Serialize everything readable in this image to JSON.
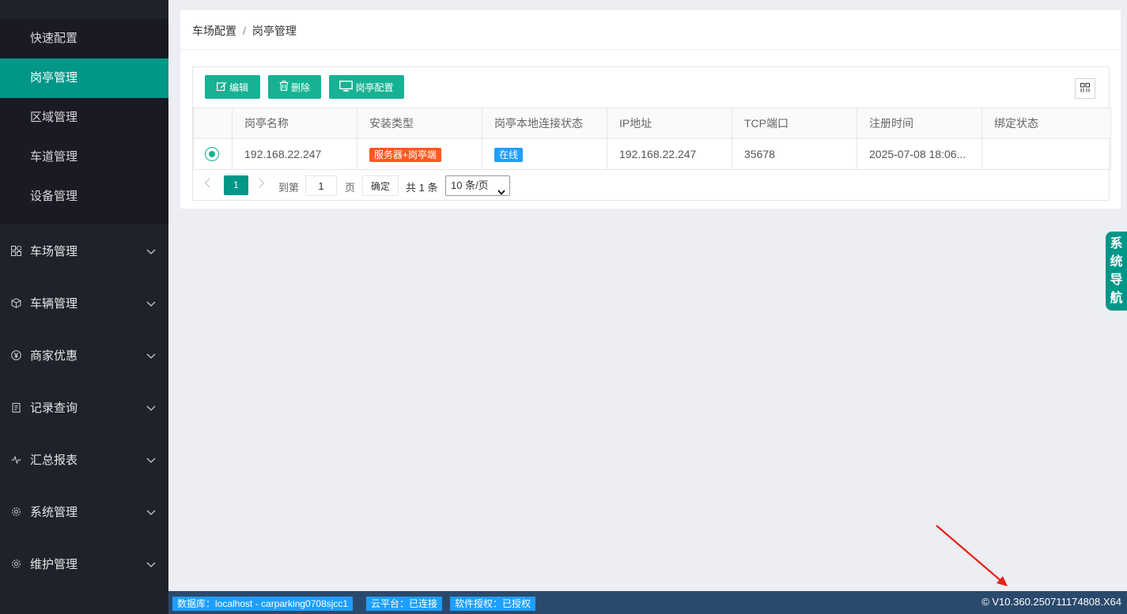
{
  "sidebar": {
    "sub_items": [
      {
        "label": "快速配置",
        "active": false
      },
      {
        "label": "岗亭管理",
        "active": true
      },
      {
        "label": "区域管理",
        "active": false
      },
      {
        "label": "车道管理",
        "active": false
      },
      {
        "label": "设备管理",
        "active": false
      }
    ],
    "groups": [
      {
        "label": "车场管理",
        "icon": "grid-icon"
      },
      {
        "label": "车辆管理",
        "icon": "cube-icon"
      },
      {
        "label": "商家优惠",
        "icon": "yen-icon"
      },
      {
        "label": "记录查询",
        "icon": "clipboard-icon"
      },
      {
        "label": "汇总报表",
        "icon": "pulse-icon"
      },
      {
        "label": "系统管理",
        "icon": "gear-icon"
      },
      {
        "label": "维护管理",
        "icon": "gear-icon"
      }
    ]
  },
  "breadcrumb": {
    "parent": "车场配置",
    "separator": "/",
    "current": "岗亭管理"
  },
  "toolbar": {
    "edit_label": "编辑",
    "delete_label": "删除",
    "config_label": "岗亭配置"
  },
  "table": {
    "columns": [
      "岗亭名称",
      "安装类型",
      "岗亭本地连接状态",
      "IP地址",
      "TCP端口",
      "注册时间",
      "绑定状态"
    ],
    "rows": [
      {
        "name": "192.168.22.247",
        "install_type": "服务器+岗亭端",
        "conn_status": "在线",
        "ip": "192.168.22.247",
        "tcp_port": "35678",
        "reg_time": "2025-07-08 18:06...",
        "bind_status": ""
      }
    ]
  },
  "pager": {
    "current_page": "1",
    "goto_label": "到第",
    "goto_value": "1",
    "page_label": "页",
    "confirm_label": "确定",
    "total_label": "共 1 条",
    "page_size": "10 条/页"
  },
  "side_nav_label": [
    "系",
    "统",
    "导",
    "航"
  ],
  "footer": {
    "db_label": "数据库：localhost - carparking0708sjcc1",
    "cloud_label": "云平台：已连接",
    "license_label": "软件授权：已授权",
    "version": "© V10.360.250711174808.X64"
  },
  "colors": {
    "primary": "#009688",
    "button": "#16b293",
    "tag_orange": "#ff5722",
    "tag_blue": "#1e9fff",
    "footer_bg": "#2a4a6d",
    "sidebar_bg": "#20222a"
  }
}
